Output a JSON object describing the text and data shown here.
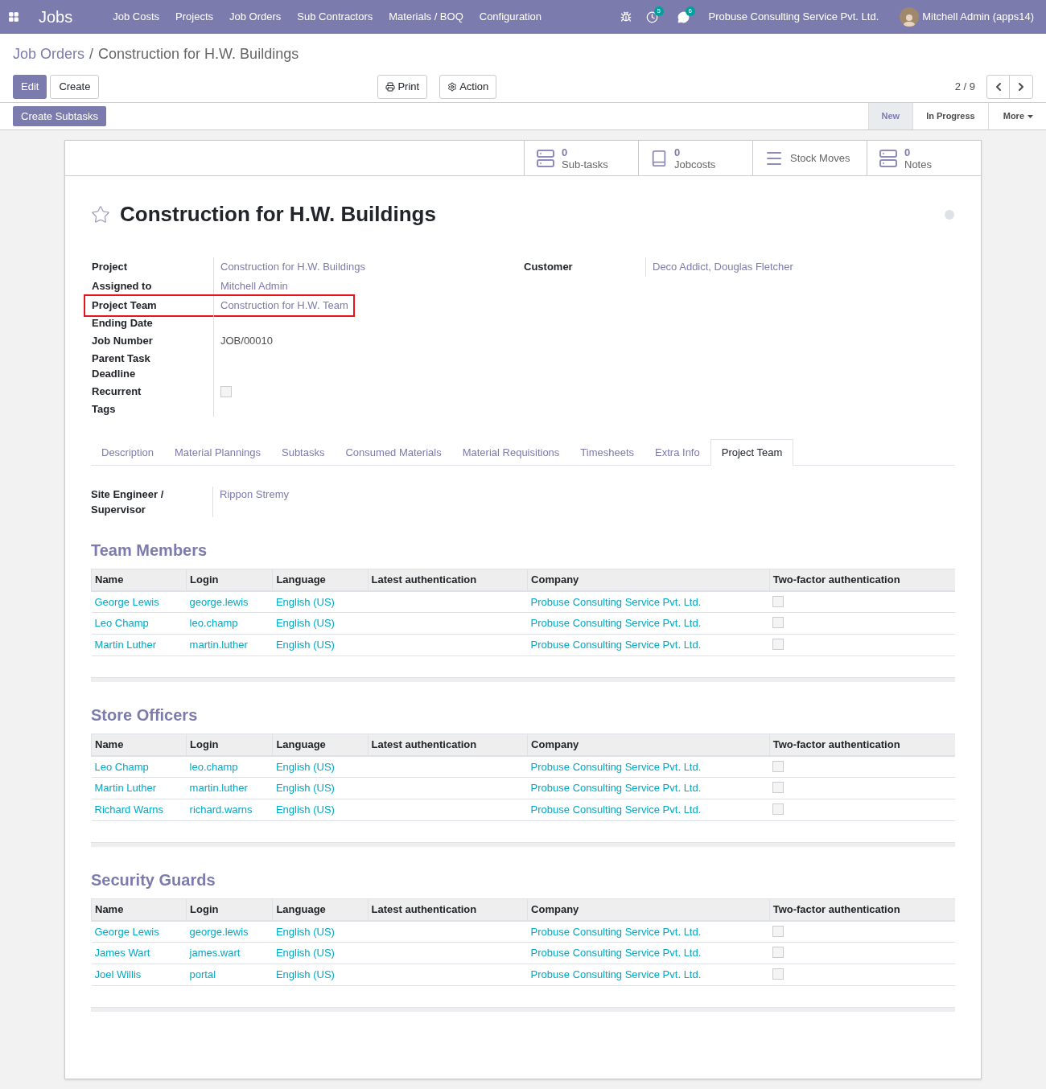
{
  "navbar": {
    "app_name": "Jobs",
    "menu": [
      "Job Costs",
      "Projects",
      "Job Orders",
      "Sub Contractors",
      "Materials / BOQ",
      "Configuration"
    ],
    "badges": [
      {
        "kind": "activity",
        "count": "5"
      },
      {
        "kind": "messages",
        "count": "6"
      }
    ],
    "company": "Probuse Consulting Service Pvt. Ltd.",
    "user": "Mitchell Admin (apps14)"
  },
  "breadcrumb": [
    "Job Orders",
    "Construction for H.W. Buildings"
  ],
  "breadcrumb_separator": "/",
  "buttons": {
    "edit": "Edit",
    "create": "Create",
    "print": "Print",
    "action": "Action"
  },
  "pager": "2 / 9",
  "create_subtasks": "Create Subtasks",
  "stages": [
    {
      "label": "New",
      "selected": true
    },
    {
      "label": "In Progress",
      "selected": false
    }
  ],
  "more": "More",
  "smart_buttons": [
    {
      "kind": "stack",
      "count": "0",
      "label": "Sub-tasks"
    },
    {
      "kind": "book",
      "count": "0",
      "label": "Jobcosts"
    },
    {
      "kind": "lines",
      "label": "Stock Moves"
    },
    {
      "kind": "stack",
      "count": "0",
      "label": "Notes"
    }
  ],
  "title": "Construction for H.W. Buildings",
  "favorite": false,
  "fields_left": [
    {
      "kind": "link",
      "label": "Project",
      "value": "Construction for H.W. Buildings",
      "highlighted": false
    },
    {
      "kind": "link",
      "label": "Assigned to",
      "value": "Mitchell Admin",
      "highlighted": false
    },
    {
      "kind": "link",
      "label": "Project Team",
      "value": "Construction for H.W. Team",
      "highlighted": true
    },
    {
      "kind": "empty",
      "label": "Ending Date",
      "highlighted": false
    },
    {
      "kind": "text",
      "label": "Job Number",
      "value": "JOB/00010",
      "highlighted": false
    },
    {
      "kind": "empty",
      "label": "Parent Task",
      "highlighted": false
    },
    {
      "kind": "empty",
      "label": "Deadline",
      "highlighted": false
    },
    {
      "kind": "checkbox",
      "label": "Recurrent",
      "checked": false,
      "highlighted": false
    },
    {
      "kind": "empty",
      "label": "Tags",
      "highlighted": false
    }
  ],
  "fields_right": [
    {
      "kind": "link",
      "label": "Customer",
      "value": "Deco Addict, Douglas Fletcher",
      "highlighted": false
    }
  ],
  "tabs": [
    {
      "label": "Description",
      "selected": false
    },
    {
      "label": "Material Plannings",
      "selected": false
    },
    {
      "label": "Subtasks",
      "selected": false
    },
    {
      "label": "Consumed Materials",
      "selected": false
    },
    {
      "label": "Material Requisitions",
      "selected": false
    },
    {
      "label": "Timesheets",
      "selected": false
    },
    {
      "label": "Extra Info",
      "selected": false
    },
    {
      "label": "Project Team",
      "selected": true
    }
  ],
  "site_engineer": {
    "label": "Site Engineer / Supervisor",
    "value": "Rippon Stremy"
  },
  "sections": [
    {
      "title": "Team Members",
      "columns": [
        "Name",
        "Login",
        "Language",
        "Latest authentication",
        "Company",
        "Two-factor authentication"
      ],
      "rows": [
        {
          "name": "George Lewis",
          "login": "george.lewis",
          "language": "English (US)",
          "company": "Probuse Consulting Service Pvt. Ltd.",
          "two_factor": false
        },
        {
          "name": "Leo Champ",
          "login": "leo.champ",
          "language": "English (US)",
          "company": "Probuse Consulting Service Pvt. Ltd.",
          "two_factor": false
        },
        {
          "name": "Martin Luther",
          "login": "martin.luther",
          "language": "English (US)",
          "company": "Probuse Consulting Service Pvt. Ltd.",
          "two_factor": false
        }
      ]
    },
    {
      "title": "Store Officers",
      "columns": [
        "Name",
        "Login",
        "Language",
        "Latest authentication",
        "Company",
        "Two-factor authentication"
      ],
      "rows": [
        {
          "name": "Leo Champ",
          "login": "leo.champ",
          "language": "English (US)",
          "company": "Probuse Consulting Service Pvt. Ltd.",
          "two_factor": false
        },
        {
          "name": "Martin Luther",
          "login": "martin.luther",
          "language": "English (US)",
          "company": "Probuse Consulting Service Pvt. Ltd.",
          "two_factor": false
        },
        {
          "name": "Richard Warns",
          "login": "richard.warns",
          "language": "English (US)",
          "company": "Probuse Consulting Service Pvt. Ltd.",
          "two_factor": false
        }
      ]
    },
    {
      "title": "Security Guards",
      "columns": [
        "Name",
        "Login",
        "Language",
        "Latest authentication",
        "Company",
        "Two-factor authentication"
      ],
      "rows": [
        {
          "name": "George Lewis",
          "login": "george.lewis",
          "language": "English (US)",
          "company": "Probuse Consulting Service Pvt. Ltd.",
          "two_factor": false
        },
        {
          "name": "James Wart",
          "login": "james.wart",
          "language": "English (US)",
          "company": "Probuse Consulting Service Pvt. Ltd.",
          "two_factor": false
        },
        {
          "name": "Joel Willis",
          "login": "portal",
          "language": "English (US)",
          "company": "Probuse Consulting Service Pvt. Ltd.",
          "two_factor": false
        }
      ]
    }
  ]
}
